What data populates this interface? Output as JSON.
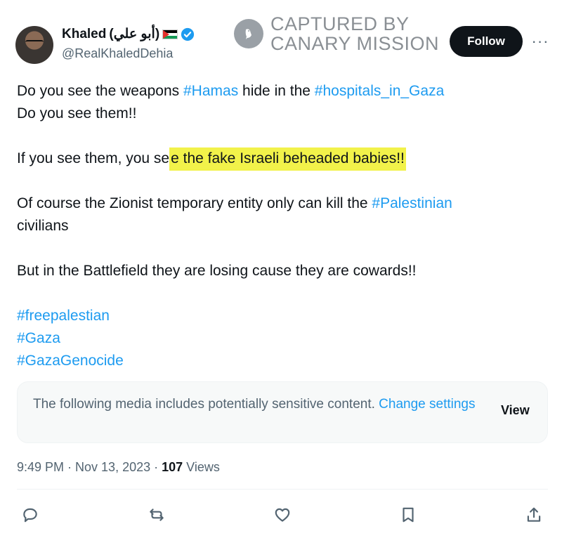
{
  "author": {
    "name": "Khaled",
    "name_suffix": "(أبو علي)",
    "handle": "@RealKhaledDehia"
  },
  "watermark": {
    "line1": "CAPTURED BY",
    "line2": "CANARY MISSION"
  },
  "follow_label": "Follow",
  "more_label": "···",
  "post": {
    "l1_a": "Do you see the weapons ",
    "l1_tag1": "#Hamas",
    "l1_b": " hide in the ",
    "l1_tag2": "#hospitals_in_Gaza",
    "l2": "Do you see them!!",
    "l3_a": "If you see them, you se",
    "l3_hl": "e the fake Israeli beheaded babies!!",
    "l4_a": "Of course the Zionist temporary entity only can kill the ",
    "l4_tag": "#Palestinian",
    "l4_b": "civilians",
    "l5": "But in the Battlefield they are losing cause they are cowards!!",
    "tag_a": "#freepalestian",
    "tag_b": "#Gaza",
    "tag_c": "#GazaGenocide"
  },
  "sensitive": {
    "text": "The following media includes potentially sensitive content. ",
    "link": "Change settings",
    "view": "View"
  },
  "meta": {
    "time": "9:49 PM · Nov 13, 2023 · ",
    "views_count": "107",
    "views_label": " Views"
  },
  "icons": {
    "reply": "reply-icon",
    "repost": "repost-icon",
    "like": "heart-icon",
    "bookmark": "bookmark-icon",
    "share": "share-icon"
  },
  "colors": {
    "link": "#1d9bf0",
    "highlight": "#f2f24a",
    "follow_bg": "#0f1419",
    "muted": "#536471"
  }
}
